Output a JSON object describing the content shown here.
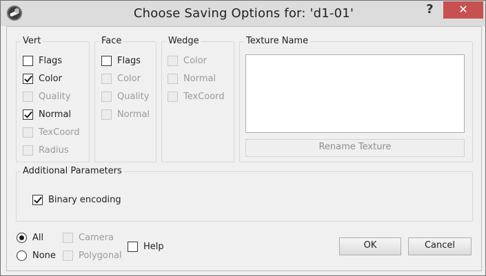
{
  "window": {
    "title": "Choose Saving Options for: 'd1-01'",
    "help_glyph": "?",
    "close_glyph": "✕"
  },
  "vert": {
    "title": "Vert",
    "items": [
      {
        "label": "Flags",
        "checked": false,
        "enabled": true
      },
      {
        "label": "Color",
        "checked": true,
        "enabled": true
      },
      {
        "label": "Quality",
        "checked": false,
        "enabled": false
      },
      {
        "label": "Normal",
        "checked": true,
        "enabled": true
      },
      {
        "label": "TexCoord",
        "checked": false,
        "enabled": false
      },
      {
        "label": "Radius",
        "checked": false,
        "enabled": false
      }
    ]
  },
  "face": {
    "title": "Face",
    "items": [
      {
        "label": "Flags",
        "checked": false,
        "enabled": true
      },
      {
        "label": "Color",
        "checked": false,
        "enabled": false
      },
      {
        "label": "Quality",
        "checked": false,
        "enabled": false
      },
      {
        "label": "Normal",
        "checked": false,
        "enabled": false
      }
    ]
  },
  "wedge": {
    "title": "Wedge",
    "items": [
      {
        "label": "Color",
        "checked": false,
        "enabled": false
      },
      {
        "label": "Normal",
        "checked": false,
        "enabled": false
      },
      {
        "label": "TexCoord",
        "checked": false,
        "enabled": false
      }
    ]
  },
  "texture": {
    "title": "Texture Name",
    "rename_label": "Rename Texture"
  },
  "additional": {
    "title": "Additional Parameters",
    "binary_label": "Binary encoding",
    "binary_checked": true
  },
  "selection": {
    "all_label": "All",
    "none_label": "None",
    "selected": "All"
  },
  "extras": {
    "camera_label": "Camera",
    "polygonal_label": "Polygonal",
    "help_label": "Help"
  },
  "buttons": {
    "ok": "OK",
    "cancel": "Cancel"
  }
}
